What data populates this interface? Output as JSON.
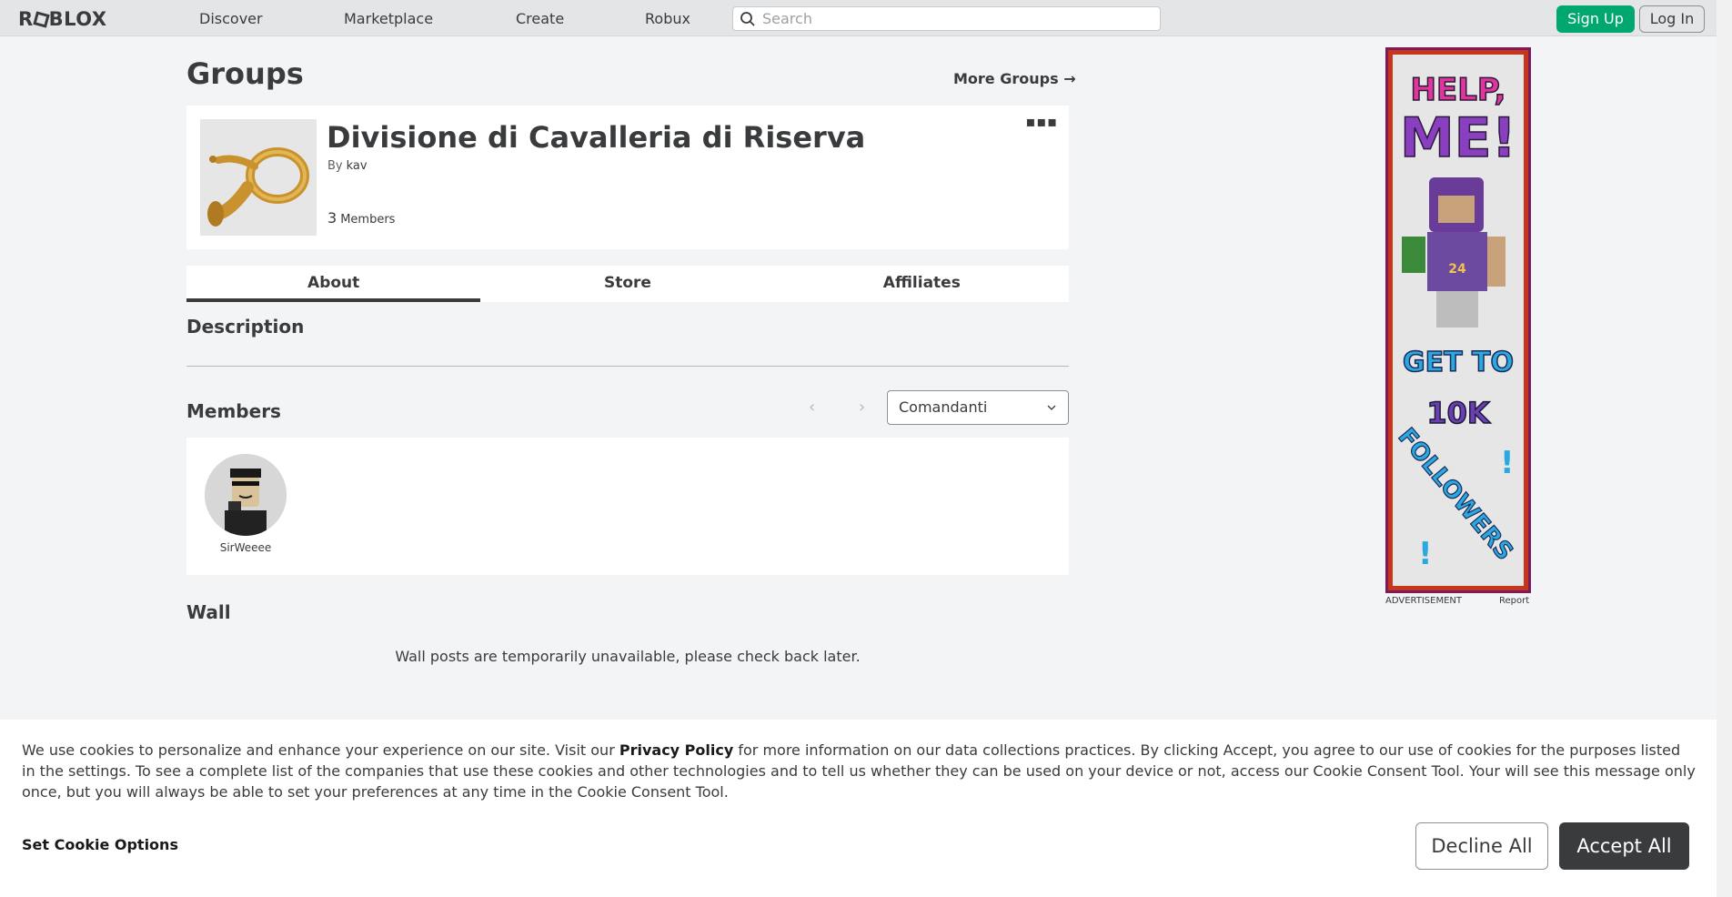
{
  "nav": {
    "logo": "ROBLOX",
    "links": [
      "Discover",
      "Marketplace",
      "Create",
      "Robux"
    ],
    "search_placeholder": "Search",
    "signup": "Sign Up",
    "login": "Log In"
  },
  "page": {
    "title": "Groups",
    "more_groups": "More Groups",
    "group": {
      "name": "Divisione di Cavalleria di Riserva",
      "by_label": "By",
      "owner": "kav",
      "member_count": "3",
      "members_label": "Members"
    },
    "tabs": [
      "About",
      "Store",
      "Affiliates"
    ],
    "active_tab": "About",
    "description_heading": "Description",
    "members_heading": "Members",
    "role_selected": "Comandanti",
    "members": [
      {
        "name": "SirWeeee"
      }
    ],
    "wall_heading": "Wall",
    "wall_message": "Wall posts are temporarily unavailable, please check back later."
  },
  "ad": {
    "label": "ADVERTISEMENT",
    "report": "Report",
    "lines": [
      "HELP,",
      "ME!",
      "GET TO",
      "10K",
      "FOLLOWERS",
      "!",
      "!"
    ]
  },
  "cookie": {
    "text_part1": "We use cookies to personalize and enhance your experience on our site. Visit our ",
    "privacy_link": "Privacy Policy",
    "text_part2": " for more information on our data collections practices. By clicking Accept, you agree to our use of cookies for the purposes listed in the settings. To see a complete list of the companies that use these cookies and other technologies and to tell us whether they can be used on your device or not, access our Cookie Consent Tool. Your will see this message only once, but you will always be able to set your preferences at any time in the Cookie Consent Tool.",
    "set_options": "Set Cookie Options",
    "decline": "Decline All",
    "accept": "Accept All"
  },
  "colors": {
    "signup_green": "#00a870",
    "accept_dark": "#393b3d",
    "background": "#f2f4f5"
  }
}
